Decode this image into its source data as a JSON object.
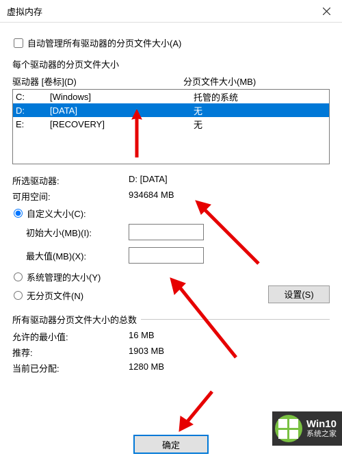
{
  "title": "虚拟内存",
  "auto_checkbox_label": "自动管理所有驱动器的分页文件大小(A)",
  "section_each_drive": "每个驱动器的分页文件大小",
  "list_headers": {
    "drive": "驱动器 [卷标](D)",
    "pagefile": "分页文件大小(MB)"
  },
  "drives": [
    {
      "letter": "C:",
      "label": "[Windows]",
      "page": "托管的系统",
      "selected": false
    },
    {
      "letter": "D:",
      "label": "[DATA]",
      "page": "无",
      "selected": true
    },
    {
      "letter": "E:",
      "label": "[RECOVERY]",
      "page": "无",
      "selected": false
    }
  ],
  "selected_drive_label": "所选驱动器:",
  "selected_drive_value": "D:  [DATA]",
  "free_space_label": "可用空间:",
  "free_space_value": "934684 MB",
  "radio_custom": "自定义大小(C):",
  "initial_size_label": "初始大小(MB)(I):",
  "max_size_label": "最大值(MB)(X):",
  "initial_size_value": "",
  "max_size_value": "",
  "radio_system": "系统管理的大小(Y)",
  "radio_none": "无分页文件(N)",
  "set_button": "设置(S)",
  "totals_heading": "所有驱动器分页文件大小的总数",
  "min_label": "允许的最小值:",
  "min_value": "16 MB",
  "rec_label": "推荐:",
  "rec_value": "1903 MB",
  "cur_label": "当前已分配:",
  "cur_value": "1280 MB",
  "ok_button": "确定",
  "watermark": {
    "line1": "Win10",
    "line2": "系统之家"
  }
}
